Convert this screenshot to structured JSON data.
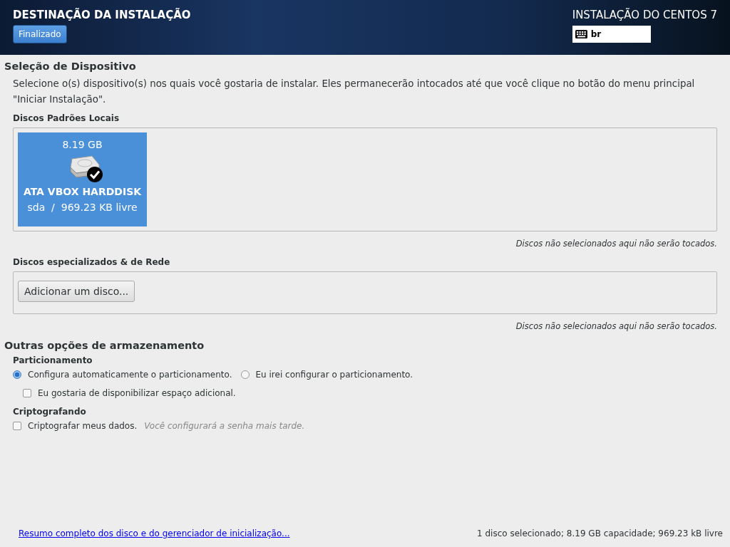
{
  "header": {
    "title": "DESTINAÇÃO DA INSTALAÇÃO",
    "done_button": "Finalizado",
    "product": "INSTALAÇÃO DO CENTOS 7",
    "keyboard": {
      "layout": "br"
    }
  },
  "device_selection": {
    "title": "Seleção de Dispositivo",
    "description": "Selecione o(s) dispositivo(s) nos quais você gostaria de instalar. Eles permanecerão intocados até que você clique no botão do menu principal \"Iniciar Instalação\".",
    "local_disks": {
      "title": "Discos Padrões Locais",
      "disks": [
        {
          "size": "8.19 GB",
          "name": "ATA VBOX HARDDISK",
          "device": "sda",
          "separator": "/",
          "free": "969.23 KB livre",
          "selected": true
        }
      ],
      "note": "Discos não selecionados aqui não serão tocados."
    },
    "specialized_disks": {
      "title": "Discos especializados & de Rede",
      "add_button": "Adicionar um disco...",
      "note": "Discos não selecionados aqui não serão tocados."
    }
  },
  "other_options": {
    "title": "Outras opções de armazenamento",
    "partitioning": {
      "title": "Particionamento",
      "options": [
        {
          "label": "Configura automaticamente o particionamento.",
          "selected": true
        },
        {
          "label": "Eu irei configurar o particionamento.",
          "selected": false
        }
      ],
      "extra_space": {
        "label": "Eu gostaria de disponibilizar espaço adicional.",
        "checked": false
      }
    },
    "encryption": {
      "title": "Criptografando",
      "checkbox": {
        "label": "Criptografar meus dados.",
        "checked": false
      },
      "hint": "Você configurará a senha mais tarde."
    }
  },
  "footer": {
    "link": "Resumo completo dos disco e do gerenciador de inicialização...",
    "summary": "1 disco selecionado; 8.19 GB capacidade; 969.23 kB livre"
  }
}
